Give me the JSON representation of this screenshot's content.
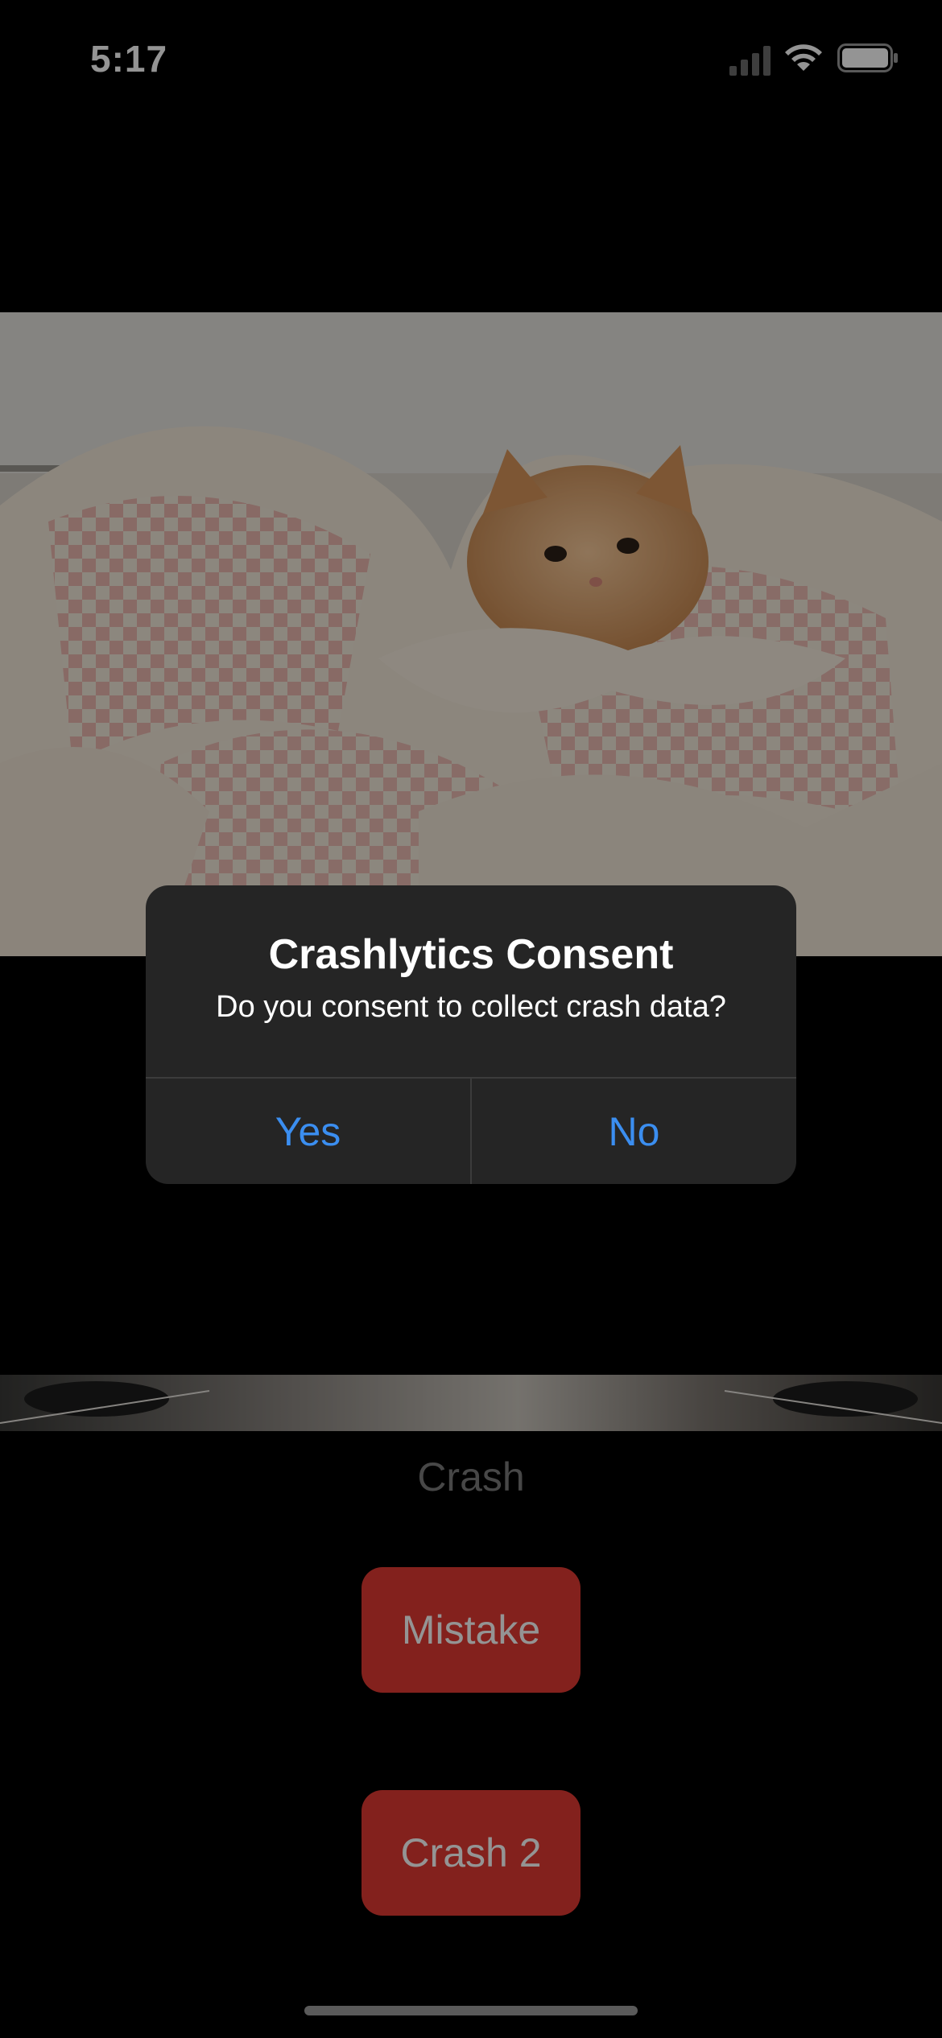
{
  "status_bar": {
    "time": "5:17"
  },
  "dialog": {
    "title": "Crashlytics Consent",
    "message": "Do you consent to collect crash data?",
    "yes_label": "Yes",
    "no_label": "No",
    "button_color": "#3b8ef0"
  },
  "screen": {
    "crash_label": "Crash",
    "mistake_label": "Mistake",
    "crash2_label": "Crash 2",
    "button_color": "#e23a32"
  }
}
